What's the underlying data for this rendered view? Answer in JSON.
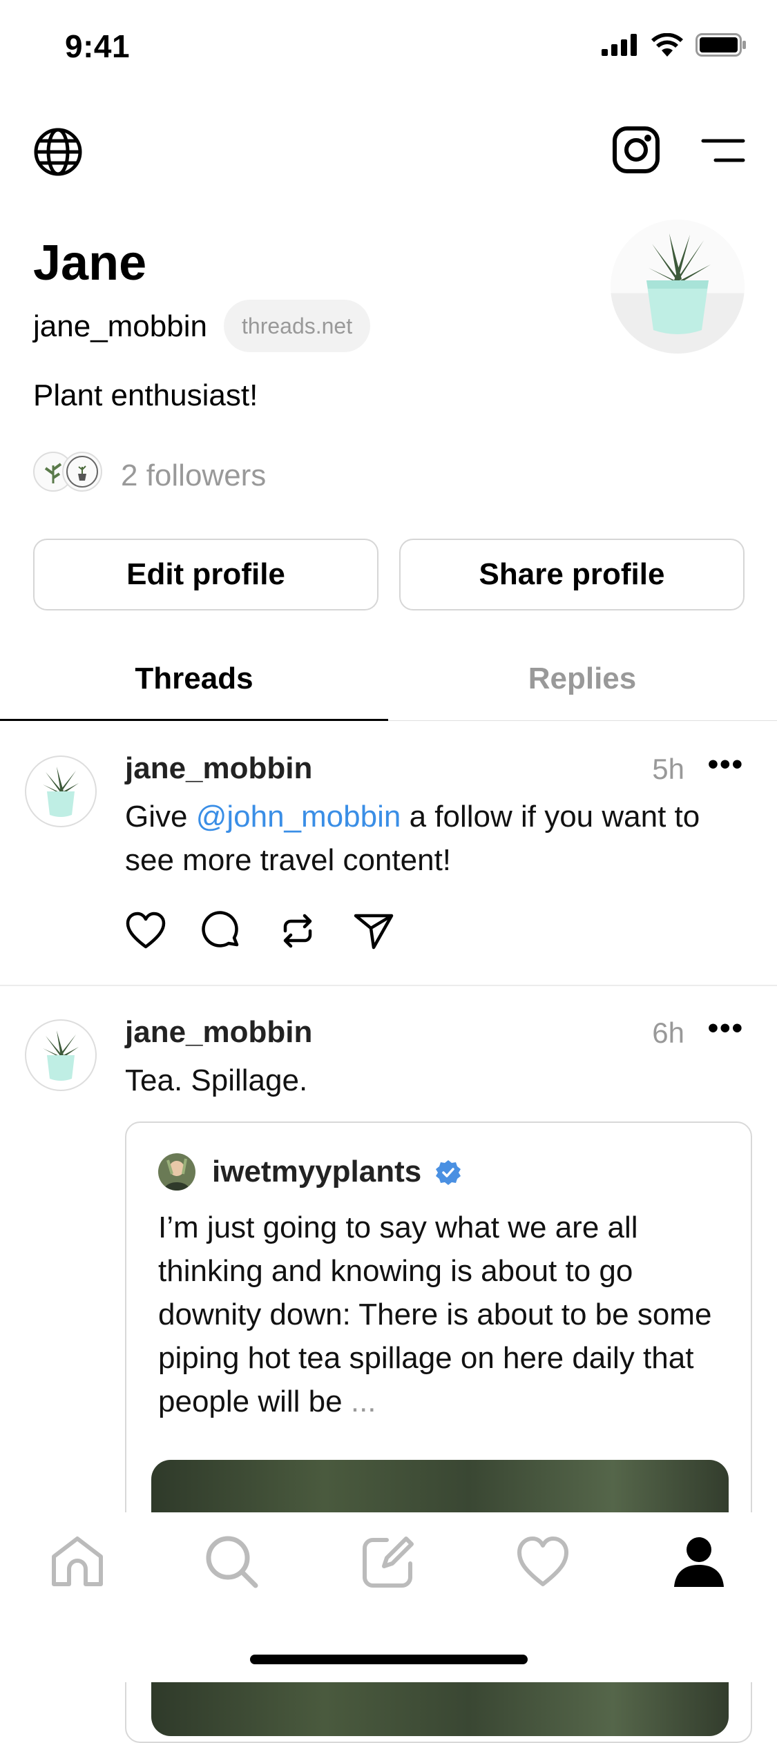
{
  "status_bar": {
    "time": "9:41"
  },
  "profile": {
    "name": "Jane",
    "handle": "jane_mobbin",
    "domain_pill": "threads.net",
    "bio": "Plant enthusiast!",
    "followers_label": "2 followers",
    "edit_button": "Edit profile",
    "share_button": "Share profile"
  },
  "tabs": [
    {
      "label": "Threads",
      "active": true
    },
    {
      "label": "Replies",
      "active": false
    }
  ],
  "posts": [
    {
      "author": "jane_mobbin",
      "time": "5h",
      "more": "•••",
      "text_before": "Give ",
      "mention": "@john_mobbin",
      "text_after": " a follow if you want to see more travel content!"
    },
    {
      "author": "jane_mobbin",
      "time": "6h",
      "more": "•••",
      "text": "Tea. Spillage.",
      "quote": {
        "author": "iwetmyyplants",
        "verified": true,
        "text": "I’m just going to say what we are all thinking and knowing is about to go downity down: There is about to be some piping hot tea spillage on here daily that people will be ",
        "ellipsis": "..."
      }
    }
  ],
  "colors": {
    "accent": "#3a8ee6",
    "muted": "#999999",
    "verified": "#4a90e2"
  },
  "bottom_nav": [
    "home-icon",
    "search-icon",
    "compose-icon",
    "heart-icon",
    "profile-icon"
  ]
}
